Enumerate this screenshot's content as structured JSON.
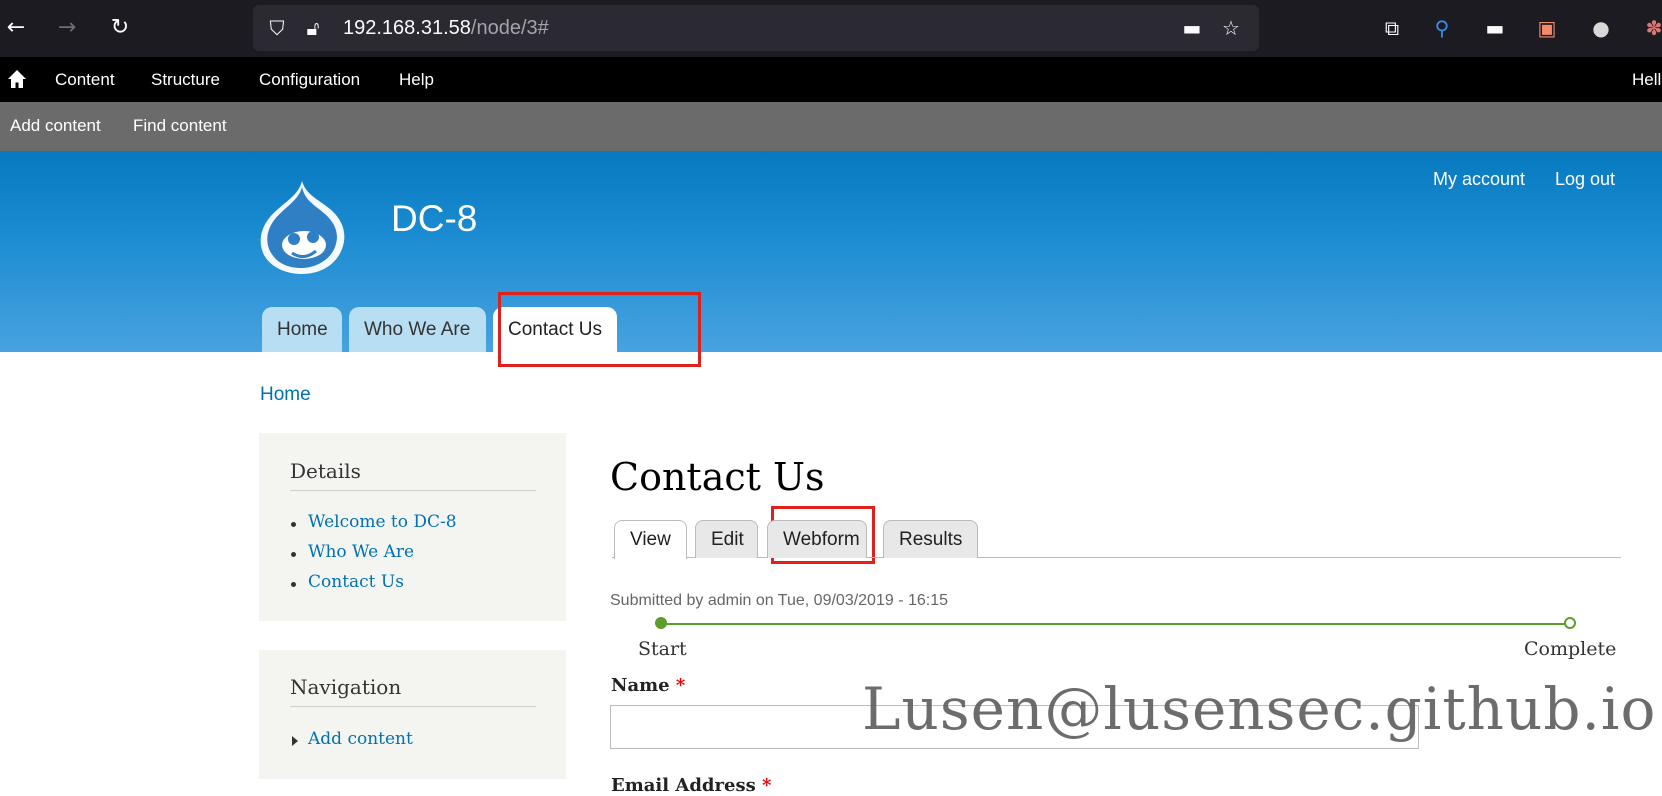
{
  "browser": {
    "url_host": "192.168.31.58",
    "url_path": "/node/3#"
  },
  "admin_toolbar": {
    "items": [
      "Content",
      "Structure",
      "Configuration",
      "Help"
    ],
    "user_greeting": "Hell",
    "tray_items": [
      "Add content",
      "Find content"
    ]
  },
  "header": {
    "site_name": "DC-8",
    "secondary_menu": [
      "My account",
      "Log out"
    ],
    "main_menu": [
      "Home",
      "Who We Are",
      "Contact Us"
    ],
    "active_main_menu": "Contact Us"
  },
  "breadcrumb": "Home",
  "sidebar": {
    "details": {
      "title": "Details",
      "links": [
        "Welcome to DC-8",
        "Who We Are",
        "Contact Us"
      ]
    },
    "navigation": {
      "title": "Navigation",
      "links": [
        "Add content"
      ]
    }
  },
  "main": {
    "title": "Contact Us",
    "tabs": [
      "View",
      "Edit",
      "Webform",
      "Results"
    ],
    "active_tab": "View",
    "submitted": "Submitted by admin on Tue, 09/03/2019 - 16:15",
    "progress": {
      "start_label": "Start",
      "end_label": "Complete"
    },
    "fields": [
      {
        "label": "Name",
        "required": "*"
      },
      {
        "label": "Email Address",
        "required": "*"
      }
    ]
  },
  "watermark": "Lusen@lusensec.github.io",
  "colors": {
    "header_top": "#0779bf",
    "header_bottom": "#48a2e0",
    "link": "#0071b3",
    "highlight_box": "#e0201b",
    "progress": "#5c9d2c"
  }
}
